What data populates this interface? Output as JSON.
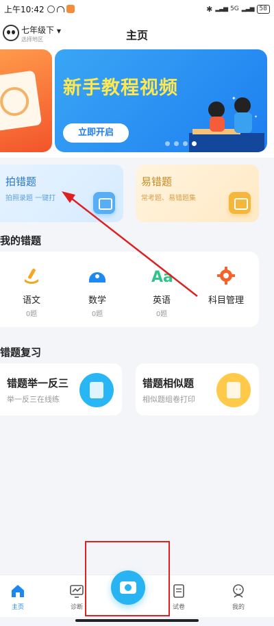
{
  "status_bar": {
    "time": "上午10:42",
    "network": "5G",
    "battery": "58",
    "notif_colors": [
      "#666666",
      "#333333",
      "#f48c3c"
    ]
  },
  "header": {
    "grade": "七年级下",
    "region": "选择地区",
    "title": "主页"
  },
  "banner": {
    "title": "新手教程视频",
    "button": "立即开启",
    "slides": 4,
    "active_slide": 4
  },
  "features": [
    {
      "title": "拍错题",
      "subtitle": "拍照录题 一键打",
      "icon": "camera-icon",
      "color": "#58aef5"
    },
    {
      "title": "易错题",
      "subtitle": "常考题、易错题集",
      "icon": "book-icon",
      "color": "#f4b73c"
    }
  ],
  "my_mistakes": {
    "title": "我的错题",
    "subjects": [
      {
        "name": "语文",
        "count": "0题",
        "icon": "chinese-brush-icon"
      },
      {
        "name": "数学",
        "count": "0题",
        "icon": "math-ruler-icon"
      },
      {
        "name": "英语",
        "count": "0题",
        "icon": "english-aa-icon"
      },
      {
        "name": "科目管理",
        "count": "",
        "icon": "gear-icon"
      }
    ]
  },
  "review": {
    "title": "错题复习",
    "cards": [
      {
        "title": "错题举一反三",
        "subtitle": "举一反三在线练",
        "icon": "practice-sheet-icon"
      },
      {
        "title": "错题相似题",
        "subtitle": "相似题组卷打印",
        "icon": "similar-doc-icon"
      }
    ]
  },
  "tabbar": {
    "tabs": [
      {
        "label": "主页",
        "icon": "home-icon"
      },
      {
        "label": "诊断",
        "icon": "diagnosis-icon"
      },
      {
        "label": "试卷",
        "icon": "paper-icon"
      },
      {
        "label": "我的",
        "icon": "profile-icon"
      }
    ],
    "center": "camera-icon"
  },
  "colors": {
    "accent": "#1a88f0",
    "annotation": "#e02020"
  }
}
